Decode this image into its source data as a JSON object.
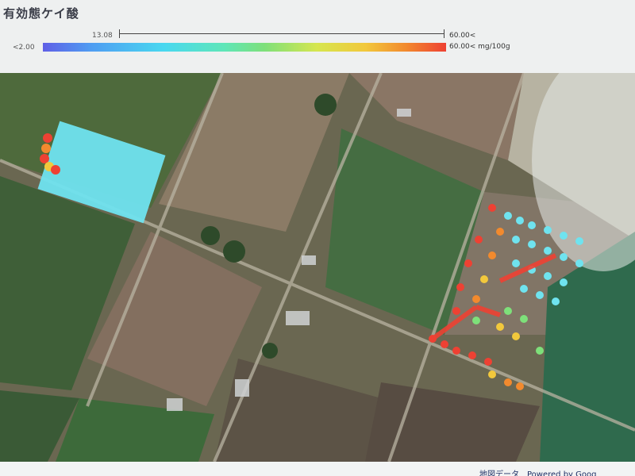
{
  "header": {
    "title": "有効態ケイ酸"
  },
  "range": {
    "min_label": "13.08",
    "max_label": "60.00<"
  },
  "legend": {
    "low_label": "<2.00",
    "high_label": "60.00<  mg/100g",
    "colors": [
      "#5f5fe6",
      "#4f9df2",
      "#49d8f0",
      "#5fe6b8",
      "#7ee07a",
      "#d6e64f",
      "#f2c83c",
      "#f28a2e",
      "#ee4133"
    ]
  },
  "map": {
    "type": "satellite"
  },
  "footer": {
    "attribution": "地図データ　Powered by Goog"
  }
}
